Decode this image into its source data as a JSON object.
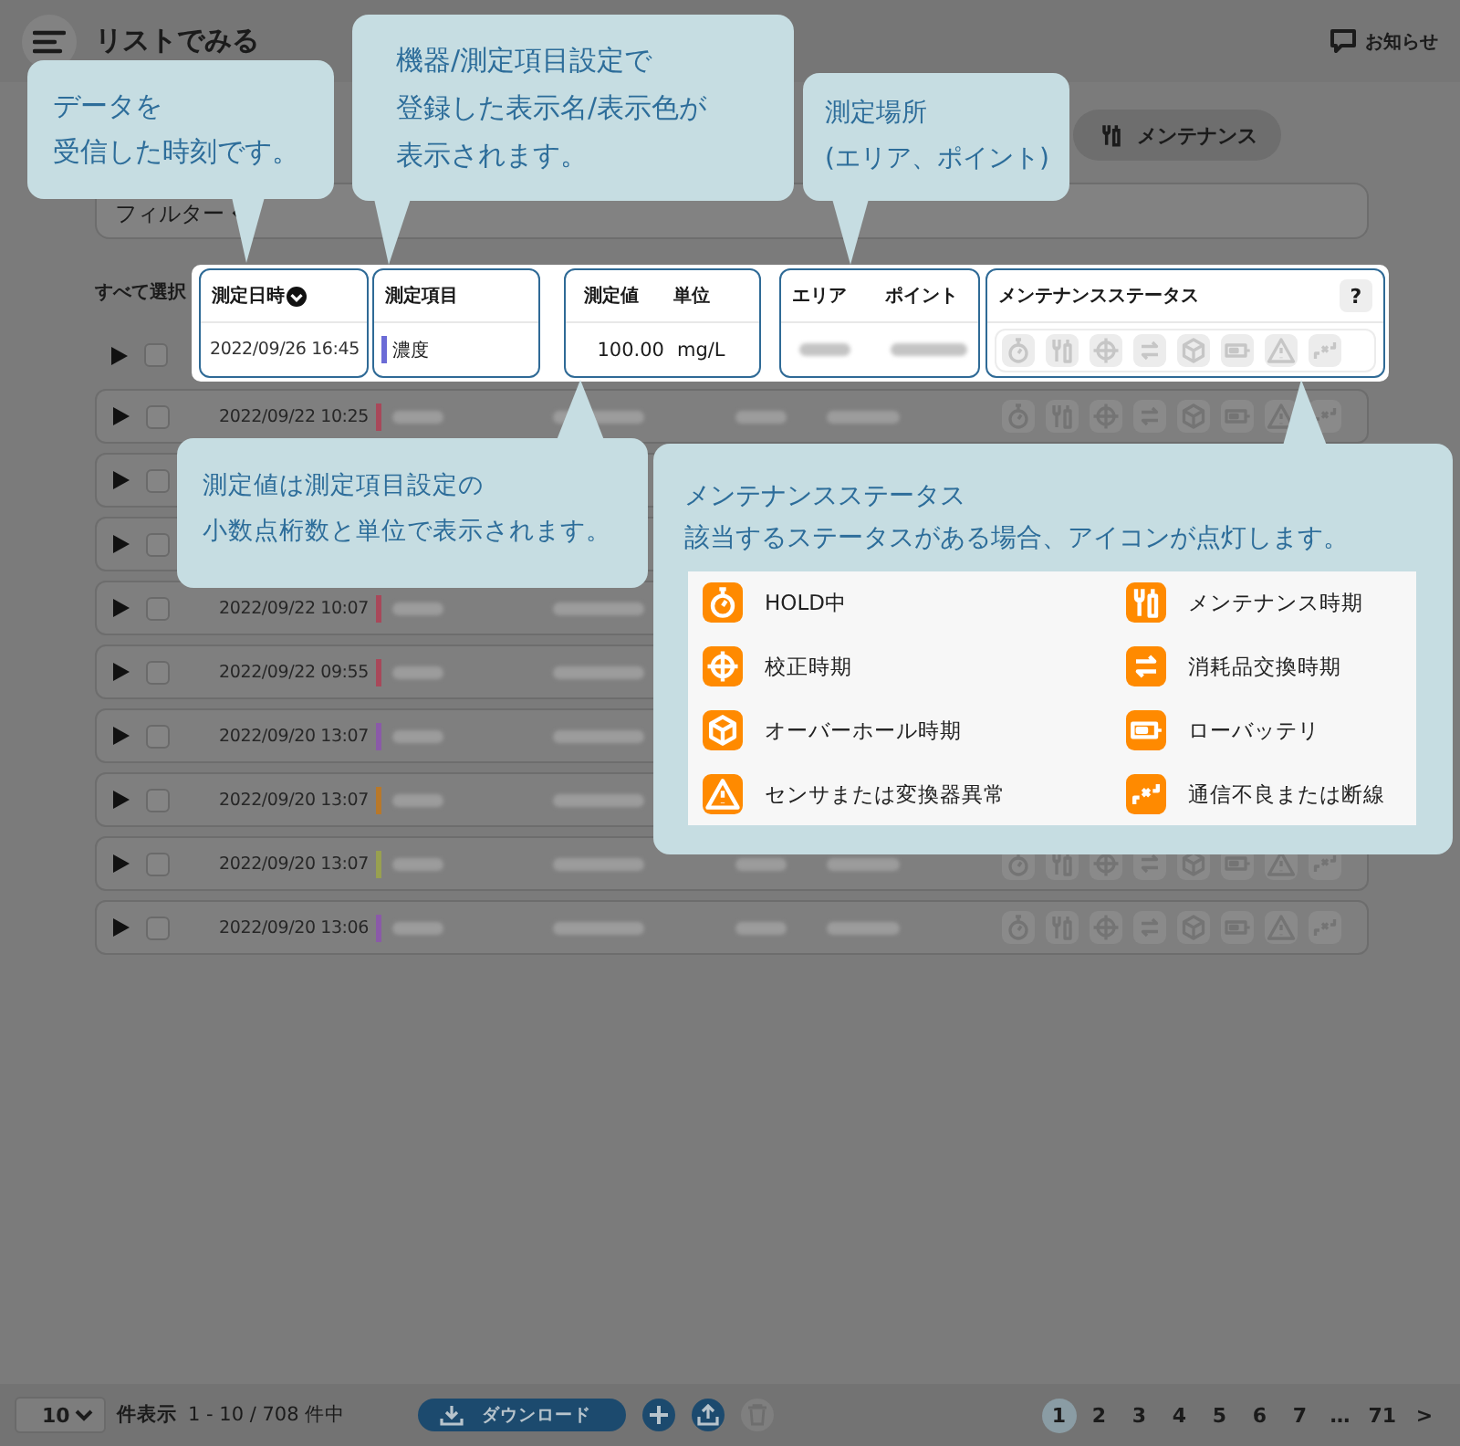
{
  "header": {
    "title": "リストでみる",
    "notice": "お知らせ"
  },
  "tabs": [
    {
      "label": "メンテナンス",
      "selected": false
    }
  ],
  "filter": {
    "label": "フィルター"
  },
  "table": {
    "select_all": "すべて選択",
    "help": "?",
    "columns": [
      {
        "label": "測定日時"
      },
      {
        "label": "測定項目"
      },
      {
        "label": "測定値"
      },
      {
        "label": "単位"
      },
      {
        "label": "エリア"
      },
      {
        "label": "ポイント"
      },
      {
        "label": "メンテナンスステータス"
      }
    ],
    "rows": [
      {
        "date": "2022/09/26 16:45",
        "color": "#6b6bd6",
        "item": "濃度",
        "value": "100.00",
        "unit": "mg/L",
        "expanded": false,
        "checked": false
      },
      {
        "date": "2022/09/22 10:25",
        "color": "#a8485a",
        "expanded": false,
        "checked": false
      },
      {
        "expanded": false,
        "checked": false
      },
      {
        "expanded": false,
        "checked": false
      },
      {
        "date": "2022/09/22 10:07",
        "color": "#a8485a",
        "expanded": false,
        "checked": false
      },
      {
        "date": "2022/09/22 09:55",
        "color": "#a8485a",
        "expanded": false,
        "checked": false
      },
      {
        "date": "2022/09/20 13:07",
        "color": "#8a5aa8",
        "expanded": false,
        "checked": false
      },
      {
        "date": "2022/09/20 13:07",
        "color": "#b8782a",
        "expanded": false,
        "checked": false
      },
      {
        "date": "2022/09/20 13:07",
        "color": "#98a050",
        "expanded": false,
        "checked": false
      },
      {
        "date": "2022/09/20 13:06",
        "color": "#8a5aa8",
        "expanded": false,
        "checked": false
      }
    ]
  },
  "callouts": [
    {
      "lines": [
        "データを",
        "受信した時刻です。"
      ]
    },
    {
      "lines": [
        "機器/測定項目設定で",
        "登録した表示名/表示色が",
        "表示されます。"
      ]
    },
    {
      "lines": [
        "測定場所",
        "(エリア、ポイント)"
      ]
    },
    {
      "lines": [
        "測定値は測定項目設定の",
        "小数点桁数と単位で表示されます。"
      ]
    },
    {
      "lines": [
        "メンテナンスステータス",
        "該当するステータスがある場合、アイコンが点灯します。"
      ],
      "legend": [
        {
          "label": "HOLD中"
        },
        {
          "label": "メンテナンス時期"
        },
        {
          "label": "校正時期"
        },
        {
          "label": "消耗品交換時期"
        },
        {
          "label": "オーバーホール時期"
        },
        {
          "label": "ローバッテリ"
        },
        {
          "label": "センサまたは変換器異常"
        },
        {
          "label": "通信不良または断線"
        }
      ]
    }
  ],
  "footer": {
    "page_size": "10",
    "page_size_label": "件表示",
    "range": "1 - 10 / 708 件中",
    "download": "ダウンロード",
    "delete_disabled": true,
    "pages": [
      {
        "label": "1",
        "selected": true
      },
      {
        "label": "2",
        "selected": false
      },
      {
        "label": "3",
        "selected": false
      },
      {
        "label": "4",
        "selected": false
      },
      {
        "label": "5",
        "selected": false
      },
      {
        "label": "6",
        "selected": false
      },
      {
        "label": "7",
        "selected": false
      },
      {
        "label": "…",
        "selected": false
      },
      {
        "label": "71",
        "selected": false
      }
    ],
    "next": ">"
  }
}
